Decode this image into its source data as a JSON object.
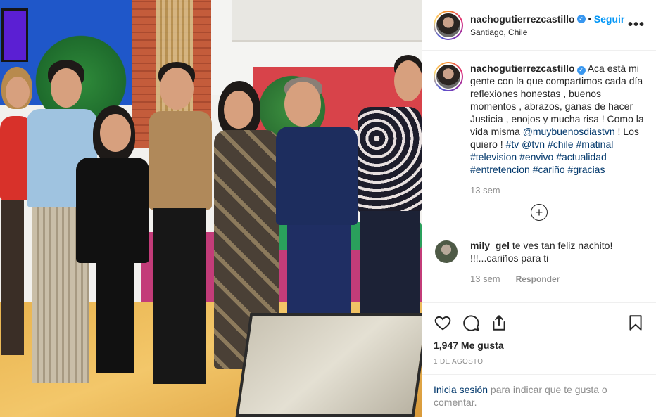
{
  "header": {
    "username": "nachogutierrezcastillo",
    "separator": "•",
    "follow_label": "Seguir",
    "location": "Santiago, Chile",
    "more_label": "•••"
  },
  "caption": {
    "username": "nachogutierrezcastillo",
    "text_before": "Aca está mi gente con la que compartimos cada día reflexiones honestas , buenos momentos , abrazos, ganas de hacer Justicia , enojos y mucha risa ! Como la vida misma ",
    "mention": "@muybuenosdiastvn",
    "text_after": " ! Los quiero ! ",
    "hashtags": [
      "#tv",
      "@tvn",
      "#chile",
      "#matinal",
      "#television",
      "#envivo",
      "#actualidad",
      "#entretencion",
      "#cariño",
      "#gracias"
    ],
    "time": "13 sem"
  },
  "load_more_label": "+",
  "comment": {
    "username": "mily_gel",
    "text": "te ves tan feliz nachito! !!!...cariños para ti",
    "time": "13 sem",
    "reply_label": "Responder"
  },
  "likes": "1,947 Me gusta",
  "date": "1 DE AGOSTO",
  "login": {
    "link": "Inicia sesión",
    "rest": " para indicar que te gusta o comentar."
  },
  "colors": {
    "link": "#00376b",
    "follow": "#0095f6",
    "verified": "#3897f0",
    "muted": "#8e8e8e"
  }
}
